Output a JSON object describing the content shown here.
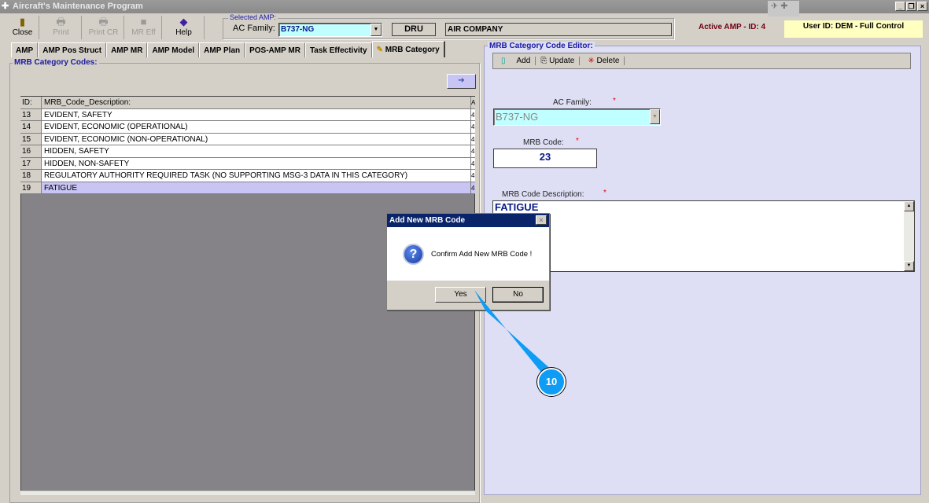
{
  "window": {
    "title": "Aircraft's Maintenance Program"
  },
  "toolbar": {
    "buttons": [
      {
        "label": "Close"
      },
      {
        "label": "Print"
      },
      {
        "label": "Print CR"
      },
      {
        "label": "MR Eff"
      },
      {
        "label": "Help"
      }
    ]
  },
  "selected_amp": {
    "legend": "Selected AMP:",
    "ac_family_label": "AC Family:",
    "ac_family": "B737-NG",
    "dru": "DRU",
    "company": "AIR COMPANY"
  },
  "status": {
    "active_amp": "Active AMP - ID: 4",
    "user": "User ID: DEM - Full Control"
  },
  "tabs": [
    "AMP",
    "AMP Pos Struct",
    "AMP MR",
    "AMP Model",
    "AMP Plan",
    "POS-AMP MR",
    "Task Effectivity",
    "MRB Category"
  ],
  "left_panel": {
    "title": "MRB Category Codes:",
    "columns": [
      "ID:",
      "MRB_Code_Description:",
      "A"
    ],
    "rows": [
      {
        "id": "13",
        "desc": "EVIDENT, SAFETY"
      },
      {
        "id": "14",
        "desc": "EVIDENT, ECONOMIC (OPERATIONAL)"
      },
      {
        "id": "15",
        "desc": "EVIDENT, ECONOMIC (NON-OPERATIONAL)"
      },
      {
        "id": "16",
        "desc": "HIDDEN, SAFETY"
      },
      {
        "id": "17",
        "desc": "HIDDEN, NON-SAFETY"
      },
      {
        "id": "18",
        "desc": "REGULATORY AUTHORITY REQUIRED TASK (NO SUPPORTING MSG-3 DATA IN THIS CATEGORY)"
      },
      {
        "id": "19",
        "desc": "FATIGUE"
      }
    ]
  },
  "editor": {
    "title": "MRB Category Code Editor:",
    "add": "Add",
    "update": "Update",
    "delete": "Delete",
    "ac_family_label": "AC Family:",
    "ac_family": "B737-NG",
    "code_label": "MRB Code:",
    "code": "23",
    "desc_label": "MRB Code Description:",
    "desc": "FATIGUE",
    "required": "*"
  },
  "dialog": {
    "title": "Add New MRB Code",
    "message": "Confirm Add New MRB Code !",
    "yes": "Yes",
    "no": "No"
  },
  "callout": {
    "step": "10"
  }
}
